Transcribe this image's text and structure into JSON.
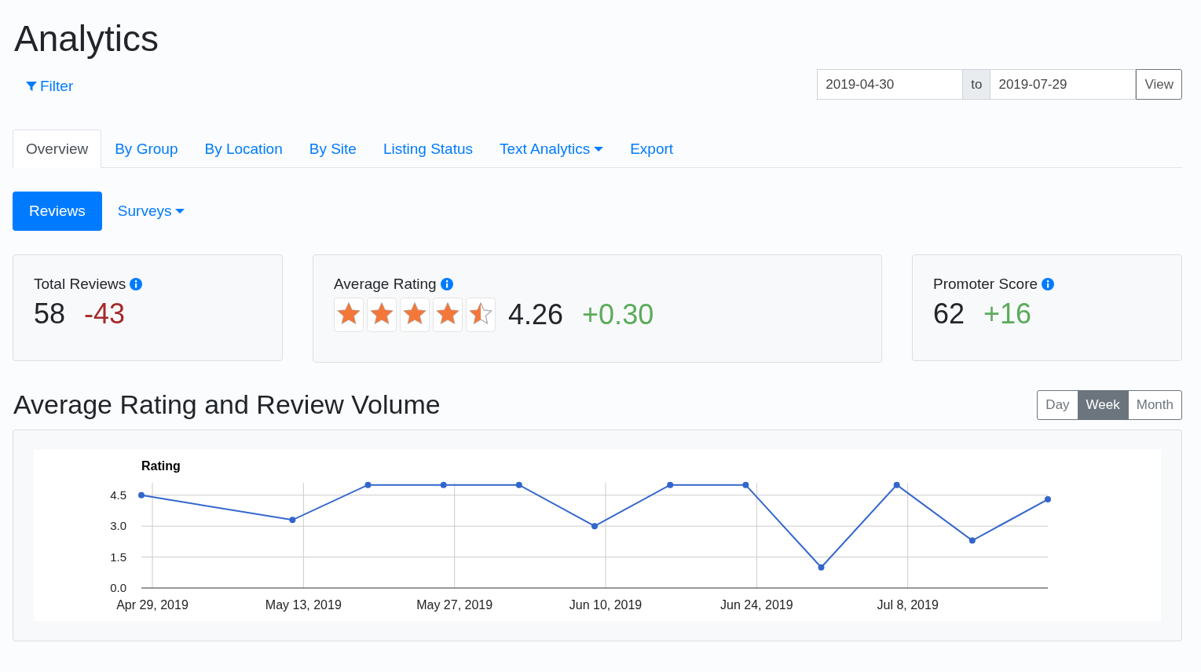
{
  "page": {
    "title": "Analytics",
    "filter": "Filter"
  },
  "date_range": {
    "from": "2019-04-30",
    "separator": "to",
    "to": "2019-07-29",
    "button": "View"
  },
  "tabs": [
    {
      "label": "Overview",
      "selected": true,
      "dropdown": false
    },
    {
      "label": "By Group",
      "selected": false,
      "dropdown": false
    },
    {
      "label": "By Location",
      "selected": false,
      "dropdown": false
    },
    {
      "label": "By Site",
      "selected": false,
      "dropdown": false
    },
    {
      "label": "Listing Status",
      "selected": false,
      "dropdown": false
    },
    {
      "label": "Text Analytics",
      "selected": false,
      "dropdown": true
    },
    {
      "label": "Export",
      "selected": false,
      "dropdown": false
    }
  ],
  "subtabs": [
    {
      "label": "Reviews",
      "selected": true,
      "dropdown": false
    },
    {
      "label": "Surveys",
      "selected": false,
      "dropdown": true
    }
  ],
  "cards": [
    {
      "kind": "plain",
      "title": "Total Reviews",
      "value": "58",
      "change": "-43",
      "color": "#a52a2a"
    },
    {
      "kind": "rating",
      "title": "Average Rating",
      "stars": 4.5,
      "value": "4.26",
      "change": "+0.30",
      "color": "#5cab5c"
    },
    {
      "kind": "plain",
      "title": "Promoter Score",
      "value": "62",
      "change": "+16",
      "color": "#5cab5c"
    }
  ],
  "chart_section": {
    "title": "Average Rating and Review Volume",
    "periods": [
      {
        "label": "Day",
        "selected": false
      },
      {
        "label": "Week",
        "selected": true
      },
      {
        "label": "Month",
        "selected": false
      }
    ],
    "chart_data": {
      "type": "line",
      "ylabel": "Rating",
      "grid": true,
      "categories": [
        "Apr 29, 2019",
        null,
        "May 13, 2019",
        null,
        "May 27, 2019",
        null,
        "Jun 10, 2019",
        null,
        "Jun 24, 2019",
        null,
        "Jul 8, 2019",
        null,
        null
      ],
      "series": [
        {
          "color": "#3366cc",
          "marker": "circle",
          "values": [
            4.5,
            null,
            3.3,
            5.0,
            5.0,
            5.0,
            3.0,
            5.0,
            5.0,
            1.0,
            5.0,
            2.3,
            4.3
          ]
        }
      ],
      "ylim": [
        0,
        5.1
      ],
      "yticks": [
        {
          "value": 0,
          "label": "0.0"
        },
        {
          "value": 1.5,
          "label": "1.5"
        },
        {
          "value": 3,
          "label": "3.0"
        },
        {
          "value": 4.5,
          "label": "4.5"
        }
      ]
    }
  }
}
